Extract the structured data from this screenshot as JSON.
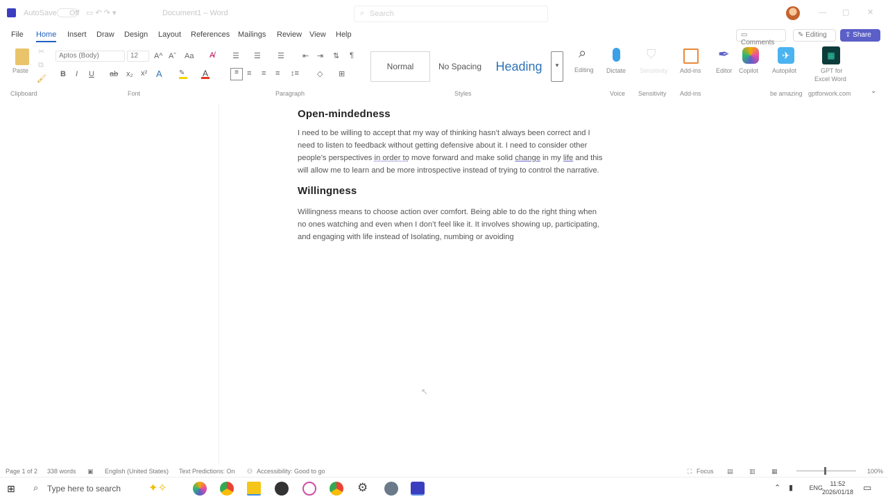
{
  "titlebar": {
    "autosave": "AutoSave",
    "autosave_state": "Off",
    "doc_title": "Document1 – Word",
    "search_placeholder": "Search"
  },
  "menu": {
    "tabs": [
      "File",
      "Home",
      "Insert",
      "Draw",
      "Design",
      "Layout",
      "References",
      "Mailings",
      "Review",
      "View",
      "Help"
    ],
    "active": "Home"
  },
  "header_buttons": {
    "comments": "Comments",
    "editing": "Editing",
    "share": "Share"
  },
  "ribbon": {
    "paste": "Paste",
    "font_name": "Aptos (Body)",
    "font_size": "12",
    "groups": {
      "clipboard": "Clipboard",
      "font": "Font",
      "paragraph": "Paragraph",
      "styles": "Styles",
      "voice": "Voice",
      "sensitivity": "Sensitivity",
      "addins": "Add-ins",
      "be_amazing": "be amazing",
      "gptforwork": "gptforwork.com"
    },
    "styles": {
      "normal": "Normal",
      "nospacing": "No Spacing",
      "heading": "Heading"
    },
    "buttons": {
      "editing": "Editing",
      "dictate": "Dictate",
      "sensitivity": "Sensitivity",
      "addins": "Add-ins",
      "editor": "Editor",
      "copilot": "Copilot",
      "autopilot": "Autopilot",
      "gpt1": "GPT for",
      "gpt2": "Excel Word"
    },
    "colors": {
      "highlight": "#f3d400",
      "font_color": "#e03a1e",
      "accent": "#1f5fbf",
      "share": "#5b5fc7",
      "heading": "#2e74b5"
    }
  },
  "document": {
    "h1": "Open-mindedness",
    "p1a": "I need to be willing to accept that my way of thinking hasn’t always been correct and I need to listen to feedback without getting defensive about it. I need to consider other people’s perspectives ",
    "p1b": "in order to",
    "p1c": " move forward and make solid ",
    "p1d": "change",
    "p1e": " in my ",
    "p1f": "life",
    "p1g": " and this will allow me to learn and be more introspective instead of trying to control the narrative.",
    "h2": "Willingness",
    "p2": "Willingness means to choose action over comfort. Being able to do the right thing when no ones watching and even when I don’t feel like it. It involves showing up, participating, and engaging with life instead of Isolating, numbing or avoiding"
  },
  "status": {
    "page": "Page 1 of 2",
    "words": "338 words",
    "language": "English (United States)",
    "predictions": "Text Predictions: On",
    "accessibility": "Accessibility: Good to go",
    "focus": "Focus",
    "zoom": "100%"
  },
  "taskbar": {
    "search": "Type here to search",
    "lang": "ENG",
    "time": "11:52",
    "date": "2026/01/18"
  }
}
